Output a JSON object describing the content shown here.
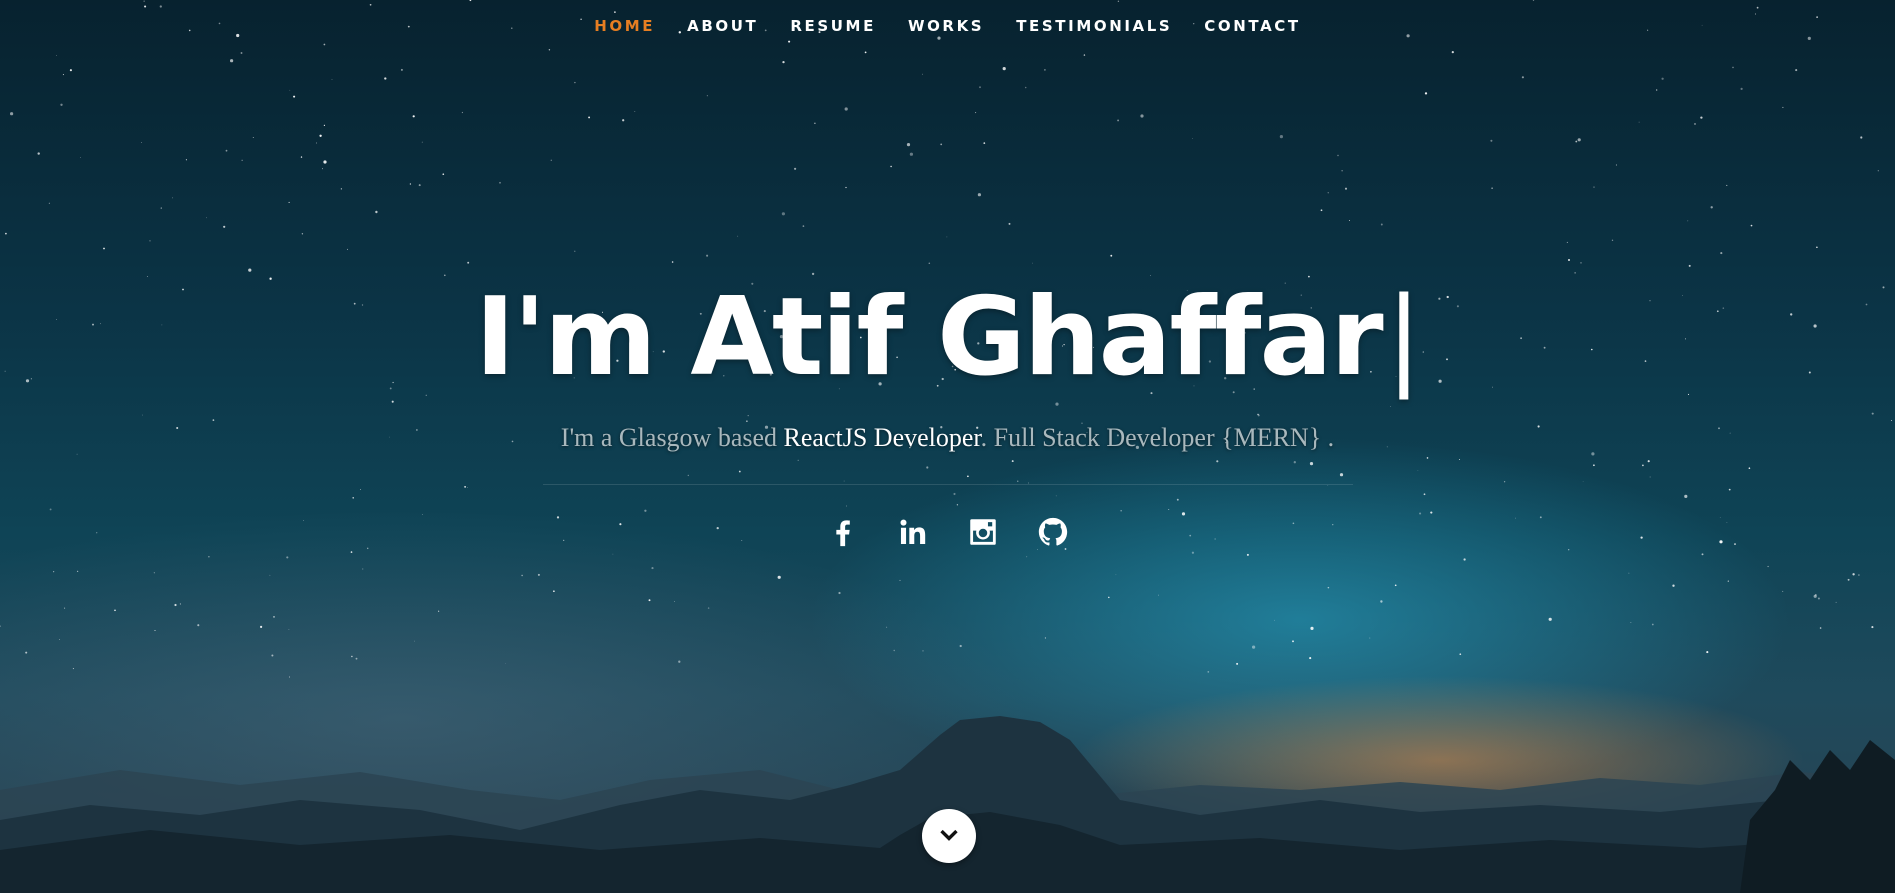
{
  "nav": {
    "items": [
      {
        "label": "HOME",
        "active": true
      },
      {
        "label": "ABOUT",
        "active": false
      },
      {
        "label": "RESUME",
        "active": false
      },
      {
        "label": "WORKS",
        "active": false
      },
      {
        "label": "TESTIMONIALS",
        "active": false
      },
      {
        "label": "CONTACT",
        "active": false
      }
    ],
    "active_color": "#e67e22"
  },
  "hero": {
    "headline": "I'm Atif Ghaffar",
    "cursor": "|",
    "tagline_prefix": "I'm a Glasgow based",
    "tagline_highlight": "ReactJS Developer",
    "tagline_suffix": ". Full Stack Developer {MERN} ."
  },
  "social": [
    {
      "icon": "facebook-icon"
    },
    {
      "icon": "linkedin-icon"
    },
    {
      "icon": "instagram-icon"
    },
    {
      "icon": "github-icon"
    }
  ],
  "scroll_button": {
    "icon": "chevron-down-icon"
  }
}
